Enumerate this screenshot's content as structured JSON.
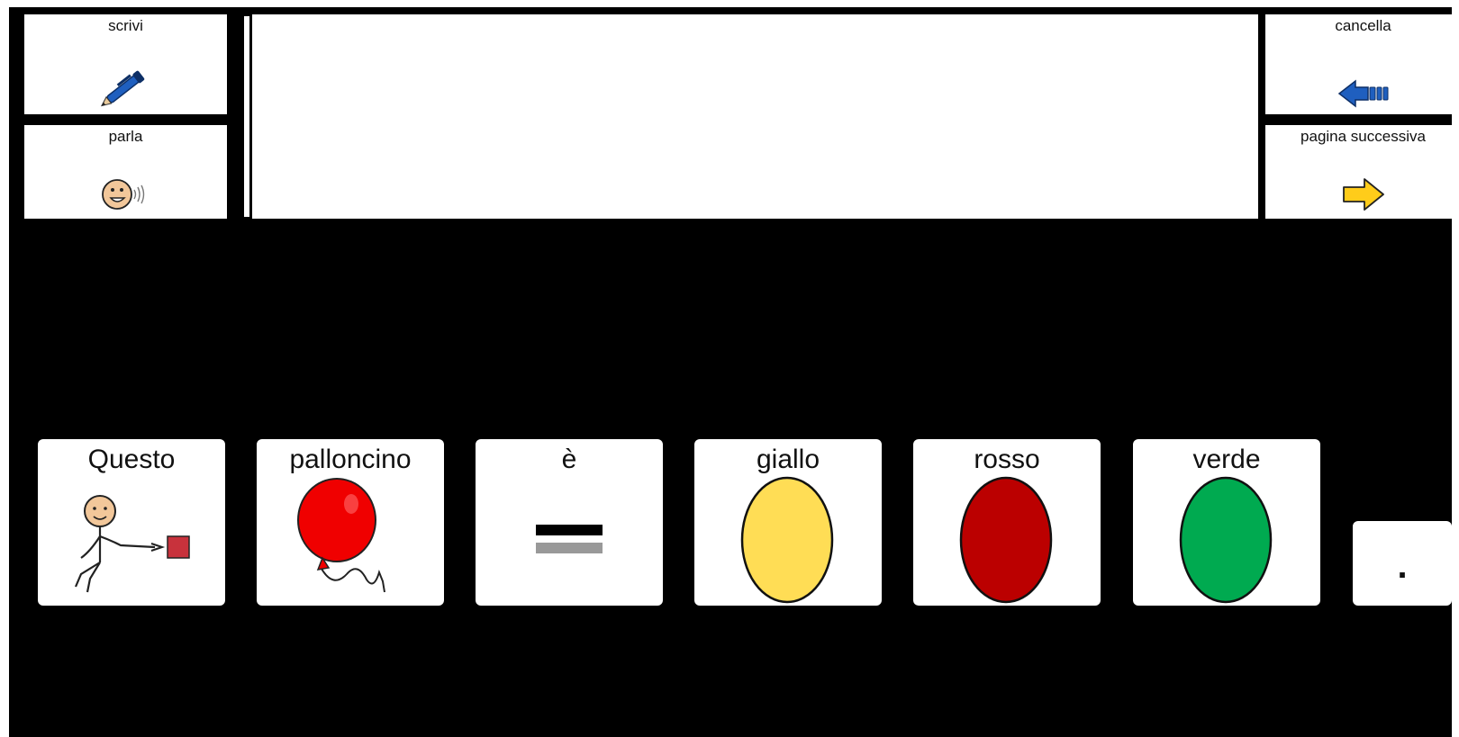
{
  "toolbar": {
    "write_label": "scrivi",
    "speak_label": "parla",
    "clear_label": "cancella",
    "next_page_label": "pagina successiva"
  },
  "message_box": {
    "text": ""
  },
  "symbols": [
    {
      "label": "Questo",
      "icon": "pointing-person-icon"
    },
    {
      "label": "palloncino",
      "icon": "red-balloon-icon"
    },
    {
      "label": "è",
      "icon": "equals-icon"
    },
    {
      "label": "giallo",
      "icon": "yellow-oval-icon",
      "color": "#FFDD55"
    },
    {
      "label": "rosso",
      "icon": "red-oval-icon",
      "color": "#BB0000"
    },
    {
      "label": "verde",
      "icon": "green-oval-icon",
      "color": "#00AA50"
    },
    {
      "label": ".",
      "icon": "period"
    }
  ],
  "colors": {
    "background": "#000000",
    "tile": "#FFFFFF",
    "pen": "#1F5FBF",
    "clear_arrow": "#1F5FBF",
    "next_arrow": "#FFCC1A"
  }
}
